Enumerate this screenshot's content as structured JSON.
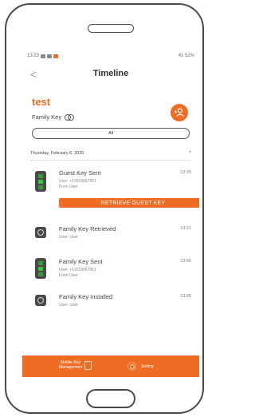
{
  "status_bar": {
    "time": "13:23",
    "right": "41 52%"
  },
  "header": {
    "back": "<",
    "title": "Timeline"
  },
  "key": {
    "name": "test",
    "type": "Family Key"
  },
  "filter": {
    "label": "All"
  },
  "date_group": {
    "date": "Thursday, February 6, 2020"
  },
  "events": [
    {
      "title": "Guest Key Sent",
      "time": "13:25",
      "lines": [
        "User: +13919067951",
        "From User"
      ],
      "action": "RETRIEVE GUEST KEY"
    },
    {
      "title": "Family Key Retrieved",
      "time": "13:21",
      "lines": [
        "User: User"
      ]
    },
    {
      "title": "Family Key Sent",
      "time": "13:06",
      "lines": [
        "User: +13919067951",
        "From User"
      ]
    },
    {
      "title": "Family Key Installed",
      "time": "13:05",
      "lines": [
        "User: User"
      ]
    }
  ],
  "bottom_nav": {
    "mobile_key_line1": "Mobile Key",
    "mobile_key_line2": "Management",
    "setting": "Setting"
  },
  "colors": {
    "accent": "#ef6c22"
  }
}
